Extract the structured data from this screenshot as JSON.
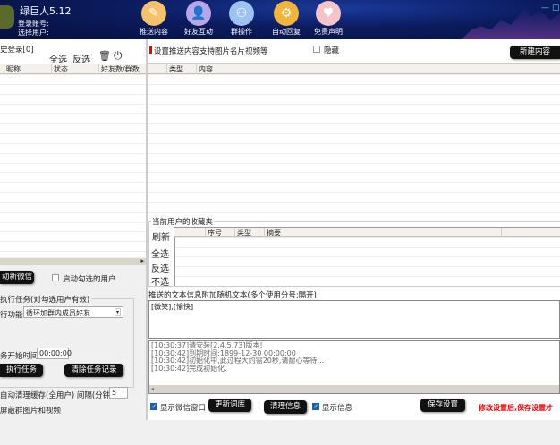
{
  "header": {
    "app_title": "绿巨人5.12",
    "login_account": "登录账号:",
    "select_user": "选择用户:",
    "minimize": "—",
    "maximize": "▢"
  },
  "nav": [
    {
      "label": "推送内容",
      "icon": "✎",
      "color": "#f5c26b"
    },
    {
      "label": "好友互动",
      "icon": "👤",
      "color": "#b9a6e8"
    },
    {
      "label": "群操作",
      "icon": "⚇",
      "color": "#9ec3f0"
    },
    {
      "label": "自动回复",
      "icon": "⚙",
      "color": "#f0b53a"
    },
    {
      "label": "免责声明",
      "icon": "♥",
      "color": "#f4c4c8"
    }
  ],
  "left": {
    "history_login": "史登录[0]",
    "select_all": "全选",
    "invert": "反选",
    "columns": [
      "昵称",
      "状态",
      "好友数/群数"
    ],
    "start_wechat": "动新微信",
    "start_checked": "启动勾选的用户",
    "task_group": "执行任务(对勾选用户有效)",
    "function_label": "行功能",
    "function_value": "循环加群内成员好友",
    "start_time_label": "务开始时间",
    "start_time_value": "00:00:00",
    "execute_task": "执行任务",
    "clear_task": "清除任务记录",
    "auto_clean": "自动清理缓存(全用户) 间隔(分钟)",
    "interval_value": "5",
    "block_media": "屏蔽群图片和视频"
  },
  "right": {
    "hint": "设置推送内容支持图片名片视频等",
    "hide": "隐藏",
    "new_content": "新建内容",
    "columns": [
      "类型",
      "内容"
    ],
    "favorites_title": "当前用户的收藏夹",
    "refresh": "刷新",
    "select_all": "全选",
    "invert": "反选",
    "none": "不选",
    "fav_columns": [
      "序号",
      "类型",
      "摘要"
    ],
    "random_text_label": "推送的文本信息附加随机文本(多个使用分号;隔开)",
    "random_text": "[微笑];[愉快]",
    "log": [
      "[10:30:37]请安装[2.4.5.73]版本!",
      "[10:30:42]到期时间:1899-12-30 00:00:00",
      "[10:30:42]初始化中,此过程大约需20秒,请耐心等待...",
      "[10:30:42]完成初始化."
    ],
    "show_wechat_window": "显示微信窗口",
    "update_lexicon": "更新词库",
    "clear_info": "清理信息",
    "show_info": "显示信息",
    "save_settings": "保存设置",
    "save_notice": "修改设置后,保存设置才"
  }
}
